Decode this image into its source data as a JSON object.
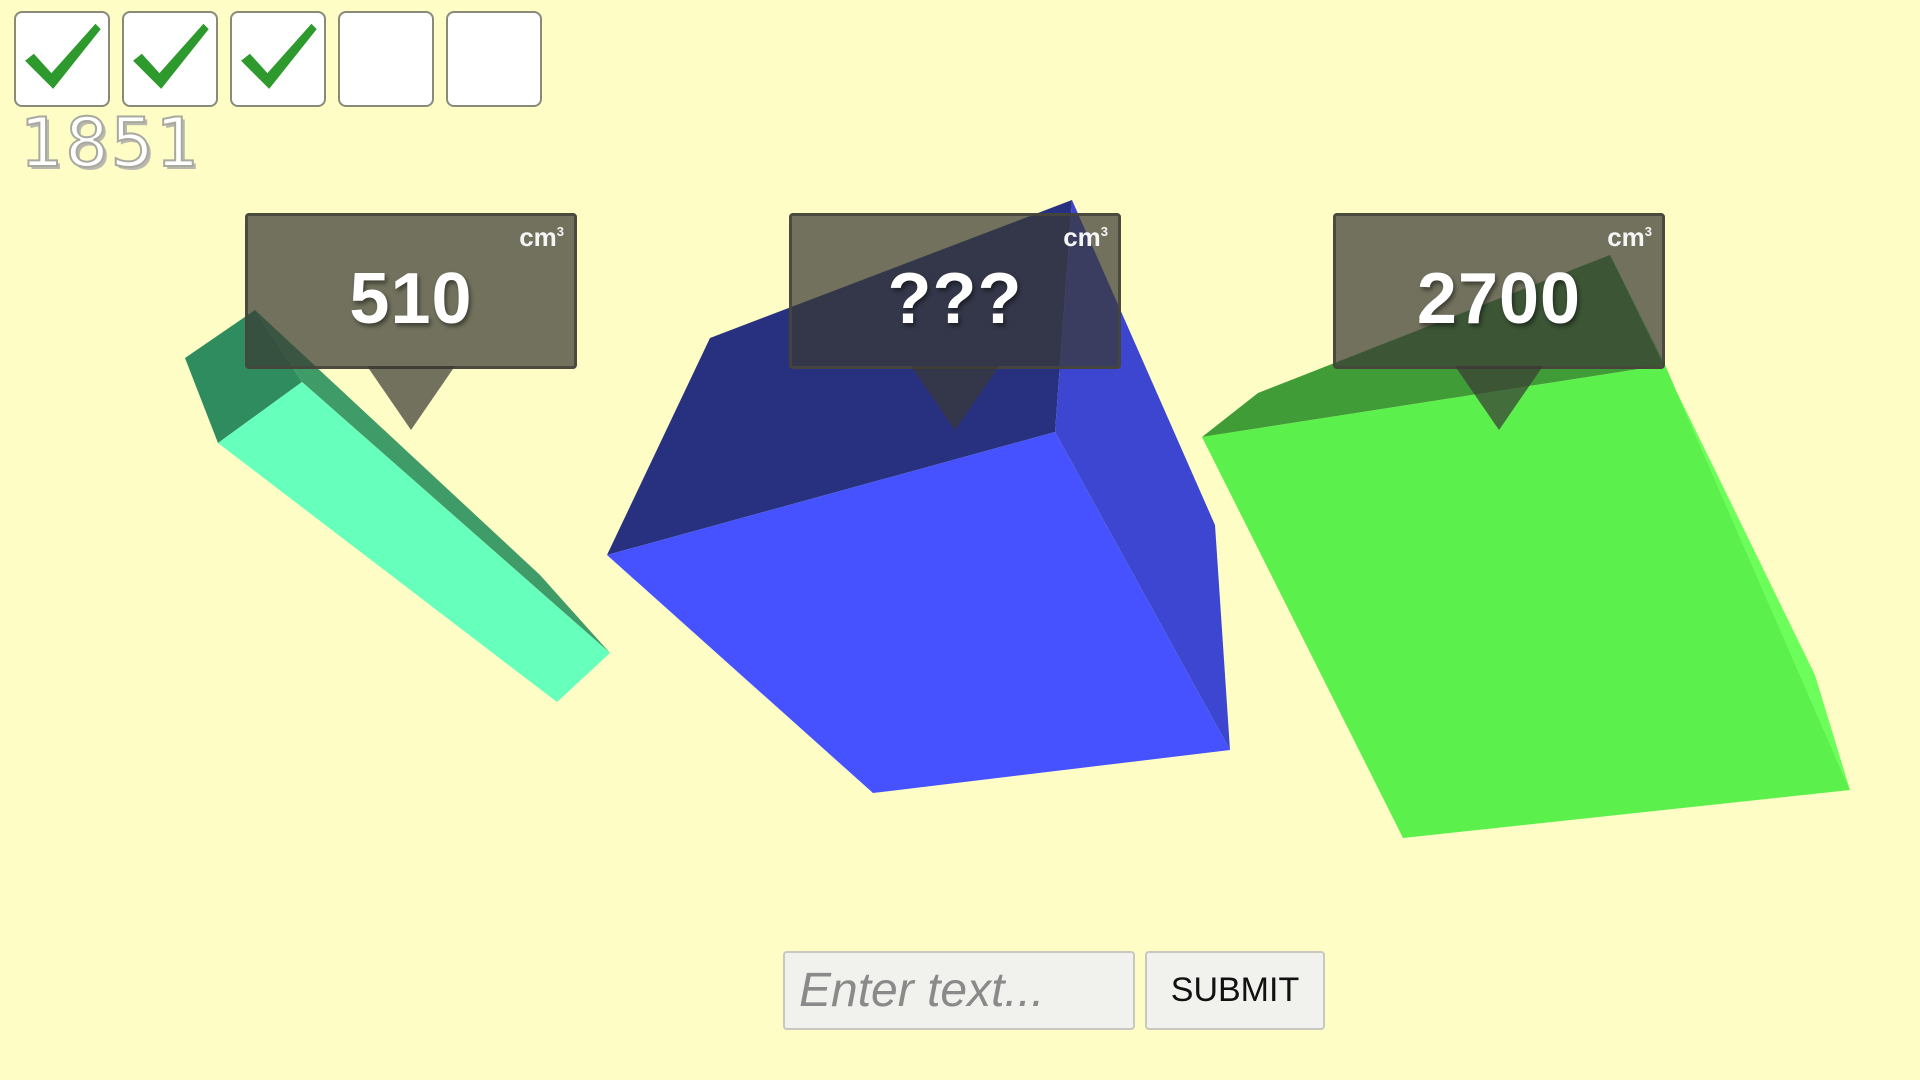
{
  "progress": {
    "boxes": [
      {
        "checked": true
      },
      {
        "checked": true
      },
      {
        "checked": true
      },
      {
        "checked": false
      },
      {
        "checked": false
      }
    ],
    "check_color": "#2e9a2e"
  },
  "score": "1851",
  "shapes": [
    {
      "name": "teal-prism",
      "color": "#66ffbb",
      "label": {
        "value": "510",
        "unit": "cm",
        "unit_exp": "3"
      }
    },
    {
      "name": "blue-cube",
      "color": "#4652ff",
      "label": {
        "value": "???",
        "unit": "cm",
        "unit_exp": "3"
      }
    },
    {
      "name": "green-box",
      "color": "#5cf04c",
      "label": {
        "value": "2700",
        "unit": "cm",
        "unit_exp": "3"
      }
    }
  ],
  "answer": {
    "placeholder": "Enter text...",
    "value": "",
    "submit_label": "SUBMIT"
  },
  "colors": {
    "background": "#fdfdc5",
    "callout": "#3a3a34"
  }
}
